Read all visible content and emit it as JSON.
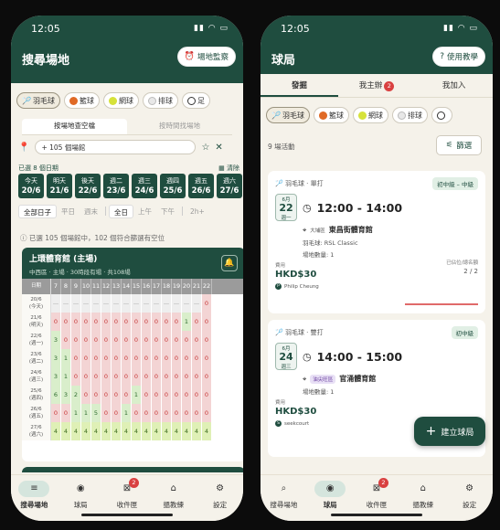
{
  "left": {
    "status": {
      "time": "12:05",
      "icons": "▮▮ ◠ ▭"
    },
    "header": {
      "title": "搜尋場地",
      "monitor_button": "場地監察"
    },
    "sports": [
      {
        "label": "羽毛球",
        "icon": "racket",
        "selected": true
      },
      {
        "label": "籃球",
        "icon": "basketball",
        "selected": false
      },
      {
        "label": "網球",
        "icon": "tennis",
        "selected": false
      },
      {
        "label": "排球",
        "icon": "volleyball",
        "selected": false
      },
      {
        "label": "足",
        "icon": "football",
        "selected": false
      }
    ],
    "search_mode": {
      "tab1": "按場地查空檔",
      "tab2": "按時間找場地"
    },
    "search": {
      "value": "105 個場館"
    },
    "selection": {
      "summary": "已選 8 個日期",
      "clear": "清除"
    },
    "dates": [
      {
        "label": "今天",
        "date": "20/6"
      },
      {
        "label": "明天",
        "date": "21/6"
      },
      {
        "label": "後天",
        "date": "22/6"
      },
      {
        "label": "週二",
        "date": "23/6"
      },
      {
        "label": "週三",
        "date": "24/6"
      },
      {
        "label": "週四",
        "date": "25/6"
      },
      {
        "label": "週五",
        "date": "26/6"
      },
      {
        "label": "週六",
        "date": "27/6"
      }
    ],
    "filters": {
      "days": [
        "全部日子",
        "平日",
        "週末"
      ],
      "times": [
        "全日",
        "上午",
        "下午"
      ],
      "duration": "2h+"
    },
    "note": "已選 105 個場館中，102 個符合篩選有空位",
    "venue": {
      "name": "上環體育館 (主場)",
      "sub": "中西區 · 主場 · 30時段有場 · 共108場",
      "grid_header": "日期",
      "hours": [
        "7",
        "8",
        "9",
        "10",
        "11",
        "12",
        "13",
        "14",
        "15",
        "16",
        "17",
        "18",
        "19",
        "20",
        "21",
        "22"
      ],
      "rows": [
        {
          "date": "20/6",
          "day": "(今天)",
          "cells": [
            "—",
            "—",
            "—",
            "—",
            "—",
            "—",
            "—",
            "—",
            "—",
            "—",
            "—",
            "—",
            "—",
            "—",
            "—",
            "0"
          ]
        },
        {
          "date": "21/6",
          "day": "(明天)",
          "cells": [
            "0",
            "0",
            "0",
            "0",
            "0",
            "0",
            "0",
            "0",
            "0",
            "0",
            "0",
            "0",
            "0",
            "1",
            "0",
            "0"
          ]
        },
        {
          "date": "22/6",
          "day": "(週一)",
          "cells": [
            "3",
            "0",
            "0",
            "0",
            "0",
            "0",
            "0",
            "0",
            "0",
            "0",
            "0",
            "0",
            "0",
            "0",
            "0",
            "0"
          ]
        },
        {
          "date": "23/6",
          "day": "(週二)",
          "cells": [
            "3",
            "1",
            "0",
            "0",
            "0",
            "0",
            "0",
            "0",
            "0",
            "0",
            "0",
            "0",
            "0",
            "0",
            "0",
            "0"
          ]
        },
        {
          "date": "24/6",
          "day": "(週三)",
          "cells": [
            "3",
            "1",
            "0",
            "0",
            "0",
            "0",
            "0",
            "0",
            "0",
            "0",
            "0",
            "0",
            "0",
            "0",
            "0",
            "0"
          ]
        },
        {
          "date": "25/6",
          "day": "(週四)",
          "cells": [
            "6",
            "3",
            "2",
            "0",
            "0",
            "0",
            "0",
            "0",
            "1",
            "0",
            "0",
            "0",
            "0",
            "0",
            "0",
            "0"
          ]
        },
        {
          "date": "26/6",
          "day": "(週五)",
          "cells": [
            "0",
            "0",
            "1",
            "1",
            "5",
            "0",
            "0",
            "1",
            "0",
            "0",
            "0",
            "0",
            "0",
            "0",
            "0",
            "0"
          ]
        },
        {
          "date": "27/6",
          "day": "(週六)",
          "cells": [
            "4",
            "4",
            "4",
            "4",
            "4",
            "4",
            "4",
            "4",
            "4",
            "4",
            "4",
            "4",
            "4",
            "4",
            "4",
            "4"
          ]
        }
      ]
    },
    "tabs": [
      {
        "label": "搜尋場地",
        "icon": "≡",
        "active": true,
        "badge": ""
      },
      {
        "label": "球局",
        "icon": "◉",
        "active": false,
        "badge": ""
      },
      {
        "label": "收件匣",
        "icon": "⊠",
        "active": false,
        "badge": "2"
      },
      {
        "label": "搵教練",
        "icon": "⌂",
        "active": false,
        "badge": ""
      },
      {
        "label": "設定",
        "icon": "⚙",
        "active": false,
        "badge": ""
      }
    ]
  },
  "right": {
    "status": {
      "time": "12:05",
      "icons": "▮▮ ◠ ▭"
    },
    "header": {
      "title": "球局",
      "help_button": "使用教學"
    },
    "top_tabs": [
      {
        "label": "發掘",
        "badge": "",
        "active": true
      },
      {
        "label": "我主辦",
        "badge": "2",
        "active": false
      },
      {
        "label": "我加入",
        "badge": "",
        "active": false
      }
    ],
    "sports": [
      {
        "label": "羽毛球",
        "icon": "racket",
        "selected": true
      },
      {
        "label": "籃球",
        "icon": "basketball",
        "selected": false
      },
      {
        "label": "網球",
        "icon": "tennis",
        "selected": false
      },
      {
        "label": "排球",
        "icon": "volleyball",
        "selected": false
      },
      {
        "label": "",
        "icon": "football",
        "selected": false
      }
    ],
    "count": "9 場活動",
    "filter_button": "篩選",
    "activities": [
      {
        "sport": "羽毛球 · 單打",
        "level": "初中級 – 中級",
        "month": "6月",
        "day": "22",
        "weekday": "週一",
        "time": "12:00 - 14:00",
        "area": "大埔區",
        "area_tag": false,
        "venue": "東昌街體育館",
        "ball": "羽毛球: RSL Classic",
        "courts": "場地數量: 1",
        "fee_label": "費用",
        "price": "HKD$30",
        "slots_label": "已佔位/總名額",
        "slots": "2 / 2",
        "host": "Philip Cheung",
        "host_initial": "P"
      },
      {
        "sport": "羽毛球 · 雙打",
        "level": "初中級",
        "month": "6月",
        "day": "24",
        "weekday": "週三",
        "time": "14:00 - 15:00",
        "area": "油尖旺區",
        "area_tag": true,
        "venue": "官涌體育館",
        "ball": "",
        "courts": "場地數量: 1",
        "fee_label": "費用",
        "price": "HKD$30",
        "slots_label": "",
        "slots": "",
        "host": "seekcourt",
        "host_initial": "S"
      }
    ],
    "fab": "建立球局",
    "tabs": [
      {
        "label": "搜尋場地",
        "icon": "⌕",
        "active": false,
        "badge": ""
      },
      {
        "label": "球局",
        "icon": "◉",
        "active": true,
        "badge": ""
      },
      {
        "label": "收件匣",
        "icon": "⊠",
        "active": false,
        "badge": "2"
      },
      {
        "label": "搵教練",
        "icon": "⌂",
        "active": false,
        "badge": ""
      },
      {
        "label": "設定",
        "icon": "⚙",
        "active": false,
        "badge": ""
      }
    ]
  }
}
